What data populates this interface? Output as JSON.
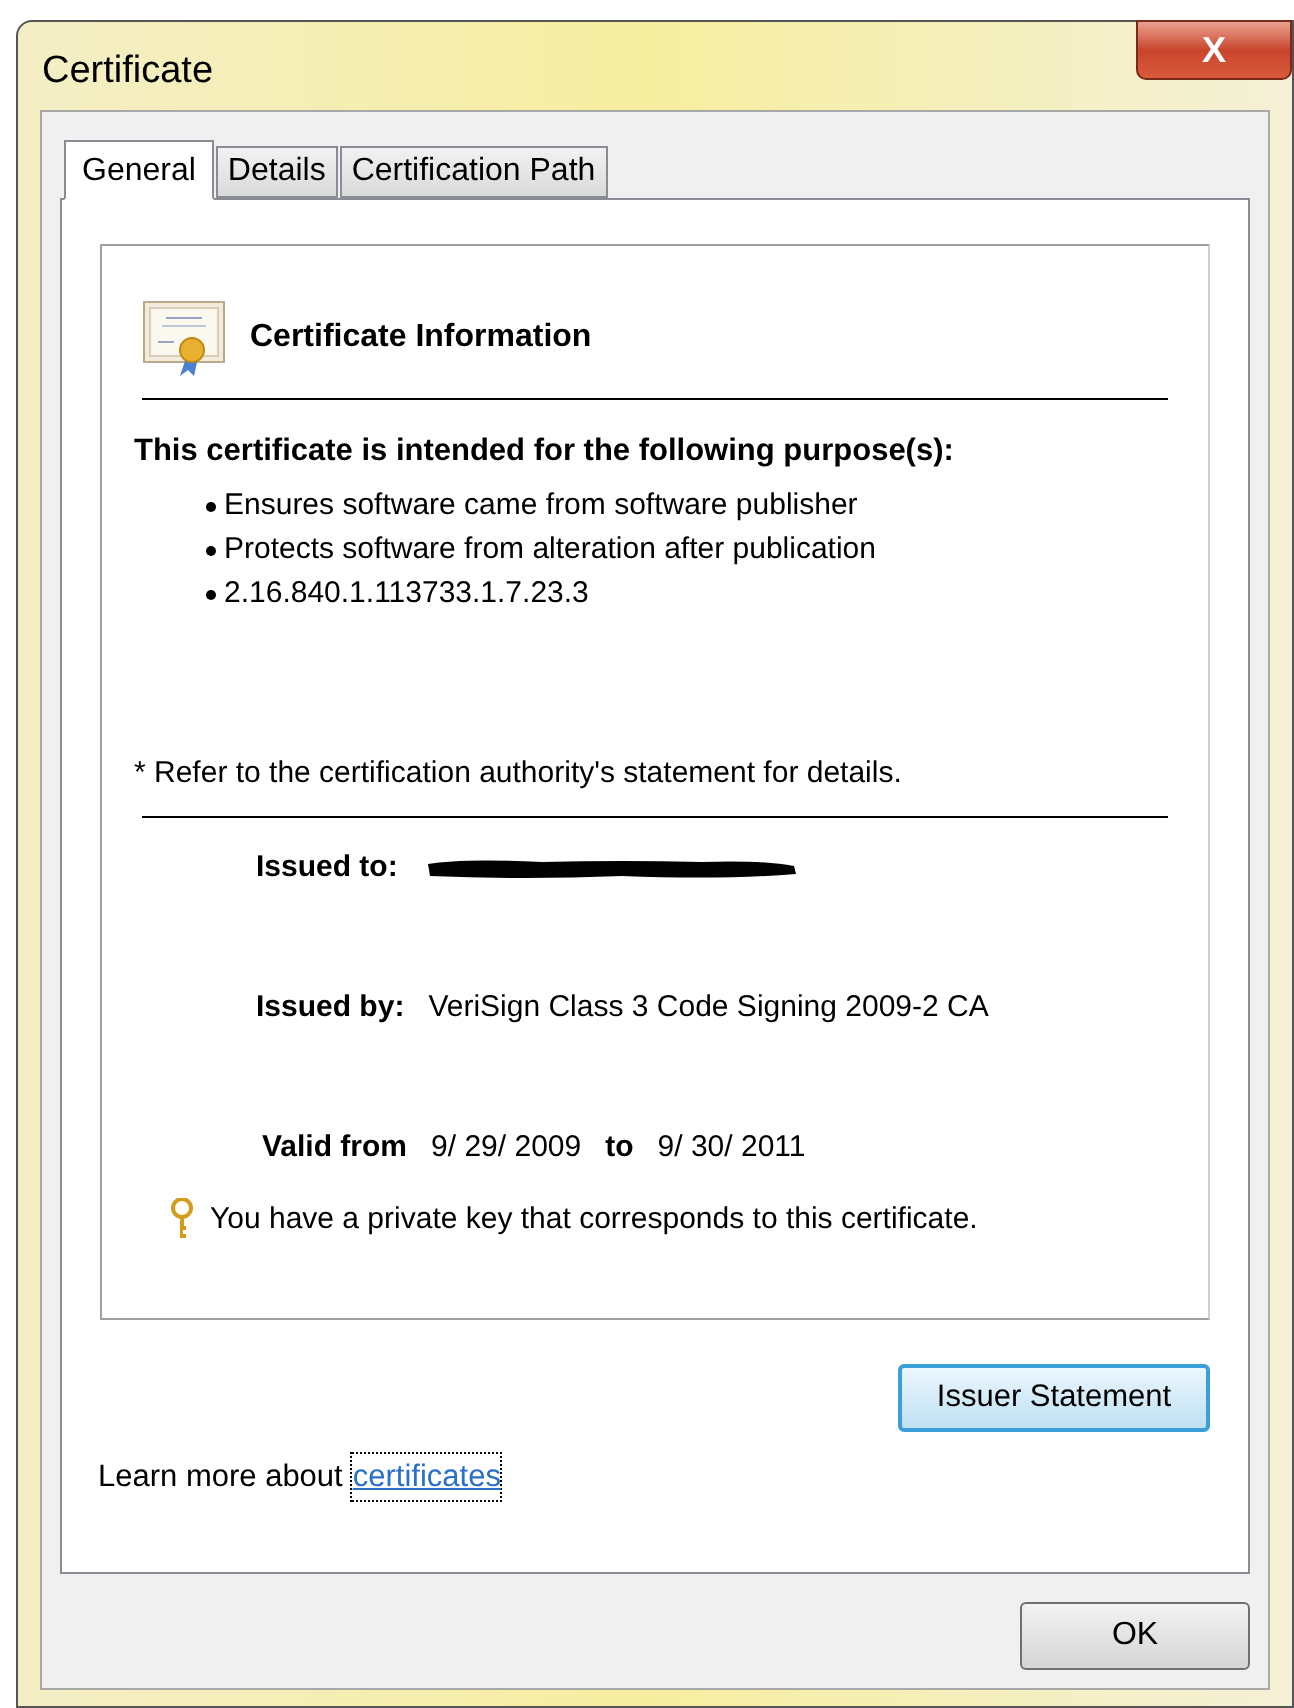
{
  "window": {
    "title": "Certificate",
    "close": "X"
  },
  "tabs": [
    {
      "label": "General",
      "selected": true
    },
    {
      "label": "Details",
      "selected": false
    },
    {
      "label": "Certification Path",
      "selected": false
    }
  ],
  "info": {
    "heading": "Certificate Information",
    "purpose_title": "This certificate is intended for the following purpose(s):",
    "purposes": [
      "Ensures software came from software publisher",
      "Protects software from alteration after publication",
      "2.16.840.1.113733.1.7.23.3"
    ],
    "note": "* Refer to the certification authority's statement for details.",
    "fields": [
      {
        "kind": "redacted",
        "label": "Issued to:"
      },
      {
        "kind": "text",
        "label": "Issued by:",
        "value": "VeriSign Class 3 Code Signing 2009-2 CA"
      }
    ],
    "validity": {
      "from_label": "Valid from",
      "from": "9/ 29/ 2009",
      "to_label": "to",
      "to": "9/ 30/ 2011"
    },
    "private_key": "You have a private key that corresponds to this certificate."
  },
  "issuer_button": "Issuer Statement",
  "learn_more": {
    "text": "Learn more about",
    "link": "certificates"
  },
  "buttons": [
    "OK"
  ]
}
